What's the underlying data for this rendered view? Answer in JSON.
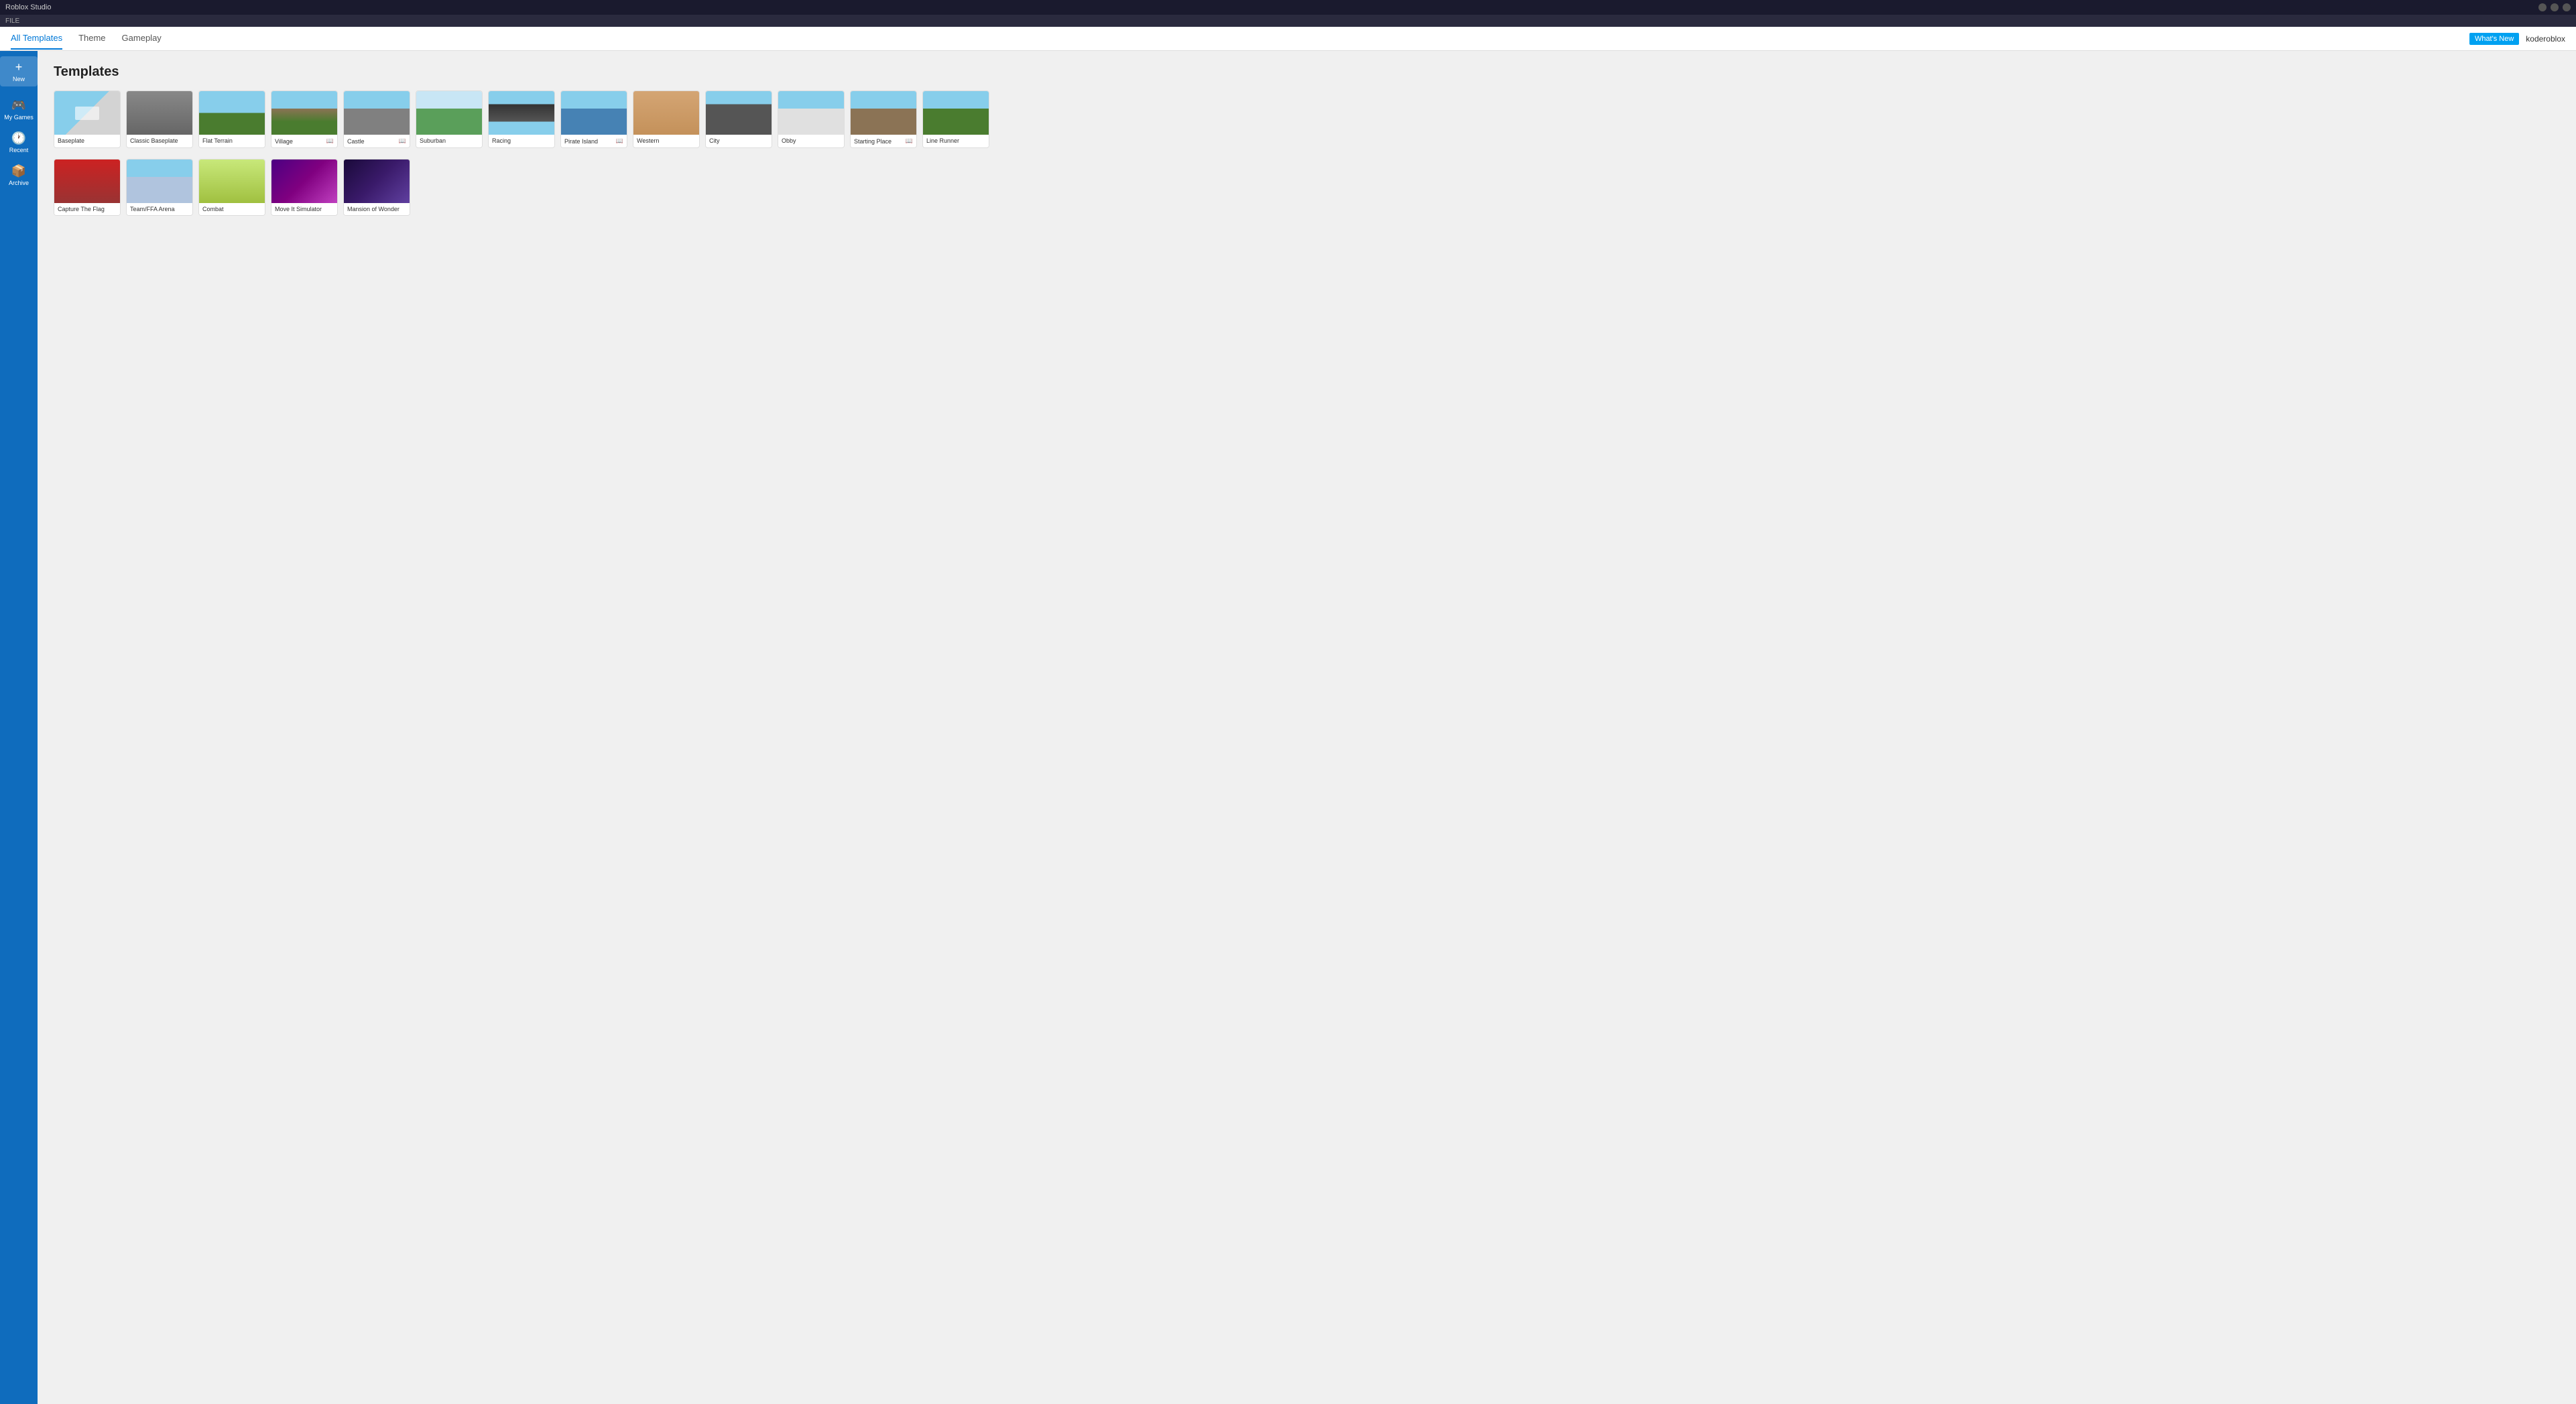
{
  "app": {
    "title": "Roblox Studio",
    "menu_items": [
      "FILE"
    ]
  },
  "topbar": {
    "tabs": [
      {
        "label": "All Templates",
        "active": true
      },
      {
        "label": "Theme",
        "active": false
      },
      {
        "label": "Gameplay",
        "active": false
      }
    ],
    "whats_new_label": "What's New",
    "username": "koderoblox"
  },
  "sidebar": {
    "items": [
      {
        "label": "New",
        "icon": "+"
      },
      {
        "label": "My Games",
        "icon": "🎮"
      },
      {
        "label": "Recent",
        "icon": "🕐"
      },
      {
        "label": "Archive",
        "icon": "📦"
      }
    ]
  },
  "content": {
    "page_title": "Templates",
    "templates_row1": [
      {
        "name": "Baseplate",
        "thumb_class": "thumb-baseplate",
        "has_book": false
      },
      {
        "name": "Classic Baseplate",
        "thumb_class": "thumb-classic",
        "has_book": false
      },
      {
        "name": "Flat Terrain",
        "thumb_class": "thumb-flat",
        "has_book": false
      },
      {
        "name": "Village",
        "thumb_class": "thumb-village",
        "has_book": true
      },
      {
        "name": "Castle",
        "thumb_class": "thumb-castle",
        "has_book": true
      },
      {
        "name": "Suburban",
        "thumb_class": "thumb-suburban",
        "has_book": false
      },
      {
        "name": "Racing",
        "thumb_class": "thumb-racing",
        "has_book": false
      },
      {
        "name": "Pirate Island",
        "thumb_class": "thumb-pirate",
        "has_book": true
      },
      {
        "name": "Western",
        "thumb_class": "thumb-western",
        "has_book": false
      },
      {
        "name": "City",
        "thumb_class": "thumb-city",
        "has_book": false
      },
      {
        "name": "Obby",
        "thumb_class": "thumb-obby",
        "has_book": false
      },
      {
        "name": "Starting Place",
        "thumb_class": "thumb-starting",
        "has_book": true
      },
      {
        "name": "Line Runner",
        "thumb_class": "thumb-linerunner",
        "has_book": false
      }
    ],
    "templates_row2": [
      {
        "name": "Capture The Flag",
        "thumb_class": "thumb-captureflag",
        "has_book": false
      },
      {
        "name": "Team/FFA Arena",
        "thumb_class": "thumb-teamarena",
        "has_book": false
      },
      {
        "name": "Combat",
        "thumb_class": "thumb-combat",
        "has_book": false
      },
      {
        "name": "Move It Simulator",
        "thumb_class": "thumb-moveit",
        "has_book": false
      },
      {
        "name": "Mansion of Wonder",
        "thumb_class": "thumb-mansion",
        "has_book": false
      }
    ]
  }
}
